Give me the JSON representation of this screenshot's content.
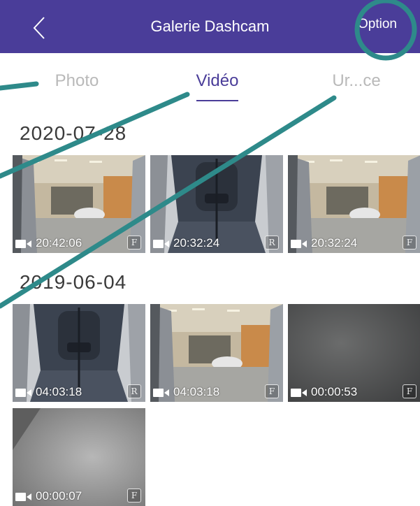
{
  "header": {
    "title": "Galerie Dashcam",
    "option_label": "Option",
    "back_icon": "chevron-left-icon",
    "background": "#4a3d99"
  },
  "tabs": [
    {
      "label": "Photo",
      "active": false
    },
    {
      "label": "Vidéo",
      "active": true
    },
    {
      "label": "Ur...ce",
      "active": false
    }
  ],
  "groups": [
    {
      "date": "2020-07-28",
      "videos": [
        {
          "duration": "20:42:06",
          "badge": "F",
          "scene": "garage"
        },
        {
          "duration": "20:32:24",
          "badge": "R",
          "scene": "seat"
        },
        {
          "duration": "20:32:24",
          "badge": "F",
          "scene": "garage"
        }
      ]
    },
    {
      "date": "2019-06-04",
      "videos": [
        {
          "duration": "04:03:18",
          "badge": "R",
          "scene": "seat"
        },
        {
          "duration": "04:03:18",
          "badge": "F",
          "scene": "garage"
        },
        {
          "duration": "00:00:53",
          "badge": "F",
          "scene": "dark"
        },
        {
          "duration": "00:00:07",
          "badge": "F",
          "scene": "grey"
        }
      ]
    }
  ],
  "annotation_color": "#2e8a8a"
}
